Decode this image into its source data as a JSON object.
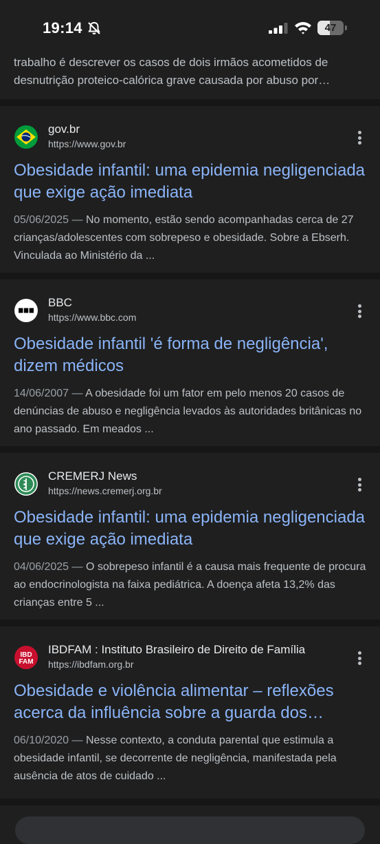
{
  "status_bar": {
    "time": "19:14",
    "battery": "47",
    "battery_level": 0.47
  },
  "previous_snippet": "trabalho é descrever os casos de dois irmãos acometidos de desnutrição proteico-calórica grave causada por abuso por…",
  "results": [
    {
      "site": "gov.br",
      "url": "https://www.gov.br",
      "title": "Obesidade infantil: uma epidemia negligenciada que exige ação imediata",
      "date": "05/06/2025 —",
      "snippet": "No momento, estão sendo acompanhadas cerca de 27 crianças/adolescentes com sobrepeso e obesidade. Sobre a Ebserh. Vinculada ao Ministério da ...",
      "favicon": "brazil-flag-icon"
    },
    {
      "site": "BBC",
      "url": "https://www.bbc.com",
      "title": "Obesidade infantil 'é forma de negligência', dizem médicos",
      "date": "14/06/2007 —",
      "snippet": "A obesidade foi um fator em pelo menos 20 casos de denúncias de abuso e negligência levados às autoridades britânicas no ano passado. Em meados ...",
      "favicon": "bbc-logo-icon"
    },
    {
      "site": "CREMERJ News",
      "url": "https://news.cremerj.org.br",
      "title": "Obesidade infantil: uma epidemia negligenciada que exige ação imediata",
      "date": "04/06/2025 —",
      "snippet": "O sobrepeso infantil é a causa mais frequente de procura ao endocrinologista na faixa pediátrica. A doença afeta 13,2% das crianças entre 5 ...",
      "favicon": "cremerj-logo-icon"
    },
    {
      "site": "IBDFAM : Instituto Brasileiro de Direito de Família",
      "url": "https://ibdfam.org.br",
      "title": "Obesidade e violência alimentar – reflexões acerca da influência sobre a guarda dos…",
      "date": "06/10/2020 —",
      "snippet": "Nesse contexto, a conduta parental que estimula a obesidade infantil, se decorrente de negligência, manifestada pela ausência de atos de cuidado ...",
      "favicon": "ibdfam-logo-icon",
      "favicon_text": [
        "IBD",
        "FAM"
      ]
    }
  ],
  "colors": {
    "background": "#1f1f1f",
    "link": "#8ab4f8",
    "text": "#bdc1c6"
  }
}
